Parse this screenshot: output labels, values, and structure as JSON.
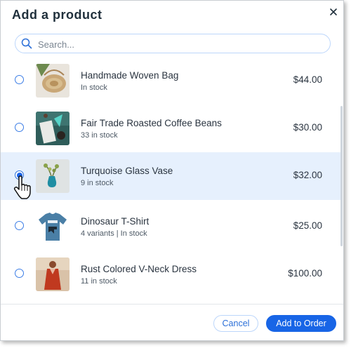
{
  "dialog": {
    "title": "Add a product",
    "close_icon": "close-icon"
  },
  "search": {
    "placeholder": "Search...",
    "icon": "search-icon"
  },
  "products": [
    {
      "name": "Handmade Woven Bag",
      "stock": "In stock",
      "price": "$44.00",
      "selected": false
    },
    {
      "name": "Fair Trade Roasted Coffee Beans",
      "stock": "33 in stock",
      "price": "$30.00",
      "selected": false
    },
    {
      "name": "Turquoise Glass Vase",
      "stock": "9 in stock",
      "price": "$32.00",
      "selected": true
    },
    {
      "name": "Dinosaur T-Shirt",
      "stock": "4 variants | In stock",
      "price": "$25.00",
      "selected": false
    },
    {
      "name": "Rust Colored V-Neck Dress",
      "stock": "11 in stock",
      "price": "$100.00",
      "selected": false
    }
  ],
  "footer": {
    "cancel_label": "Cancel",
    "confirm_label": "Add to Order"
  },
  "colors": {
    "accent": "#1865e6",
    "selected_row": "#e6f0fd",
    "text": "#20303c"
  }
}
